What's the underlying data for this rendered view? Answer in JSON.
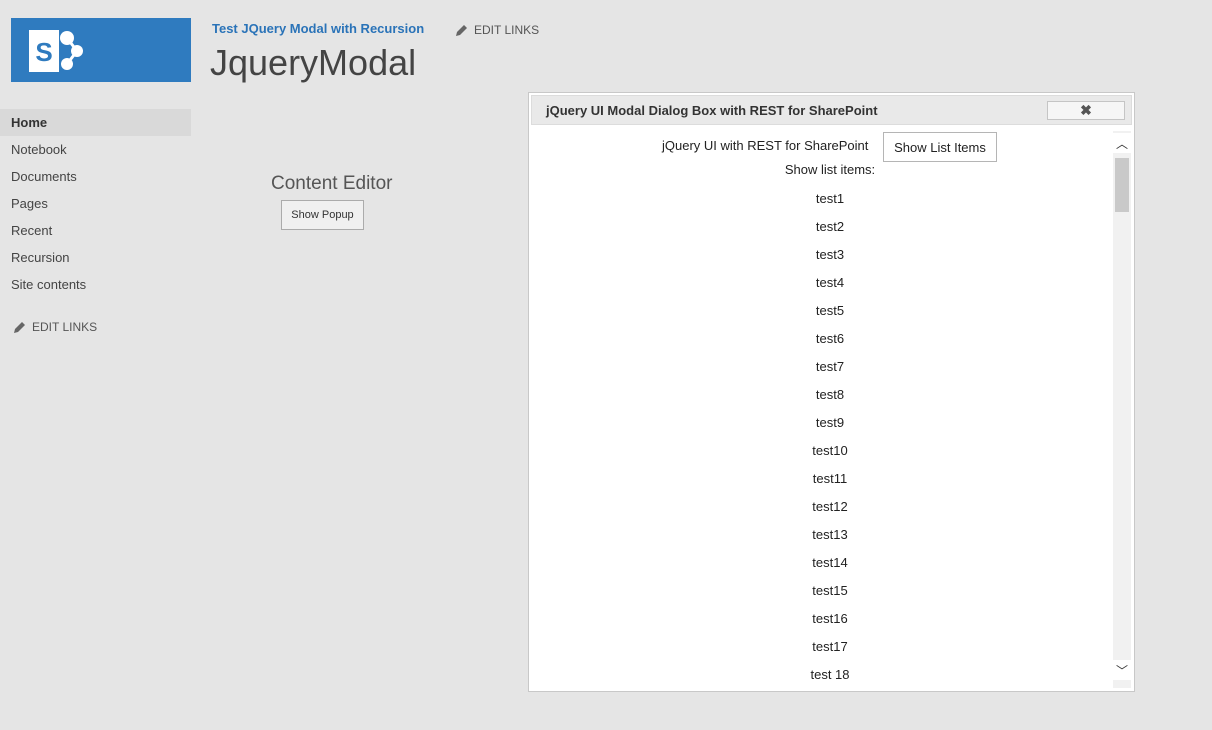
{
  "site": {
    "link": "Test JQuery Modal with Recursion",
    "title": "JqueryModal",
    "edit_links": "EDIT LINKS"
  },
  "quicklaunch": {
    "items": [
      {
        "label": "Home",
        "selected": true
      },
      {
        "label": "Notebook"
      },
      {
        "label": "Documents"
      },
      {
        "label": "Pages"
      },
      {
        "label": "Recent"
      },
      {
        "label": "Recursion"
      },
      {
        "label": "Site contents"
      }
    ],
    "edit_links": "EDIT LINKS"
  },
  "webpart": {
    "title": "Content Editor",
    "button": "Show Popup"
  },
  "dialog": {
    "title": "jQuery UI Modal Dialog Box with REST for SharePoint",
    "close_icon": "close-icon",
    "header_text": "jQuery UI with REST for SharePoint",
    "show_button": "Show List Items",
    "list_label": "Show list items:",
    "items": [
      "test1",
      "test2",
      "test3",
      "test4",
      "test5",
      "test6",
      "test7",
      "test8",
      "test9",
      "test10",
      "test11",
      "test12",
      "test13",
      "test14",
      "test15",
      "test16",
      "test17",
      "test 18"
    ]
  },
  "colors": {
    "brand": "#2f7bbf",
    "link": "#2a73b8",
    "background": "#e5e5e5"
  }
}
